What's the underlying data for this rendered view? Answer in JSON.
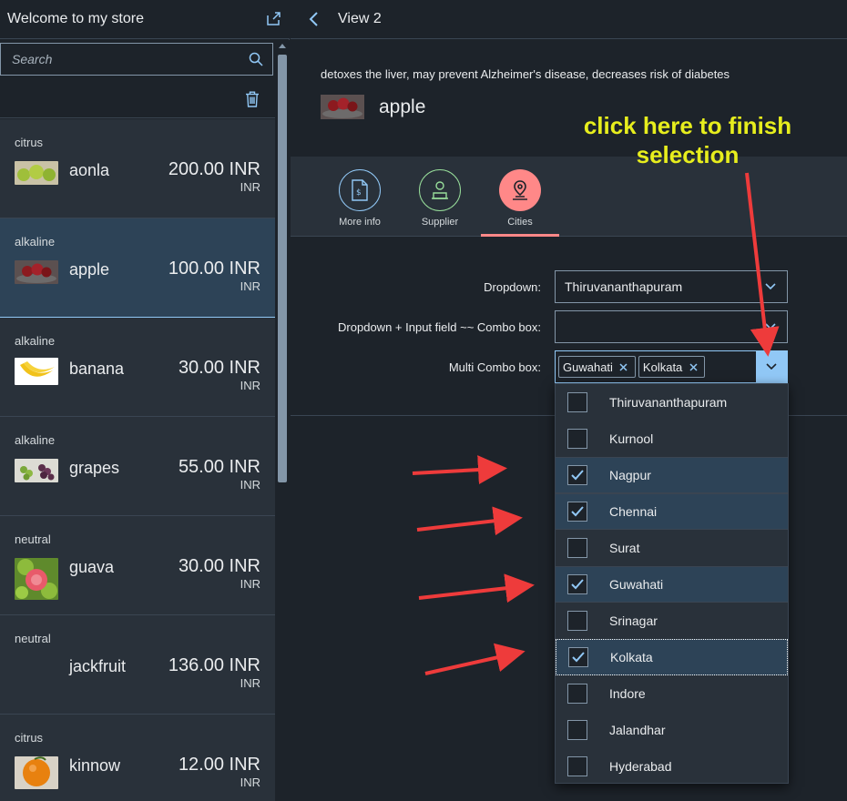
{
  "master": {
    "title": "Welcome to my store",
    "search_placeholder": "Search",
    "items": [
      {
        "category": "citrus",
        "name": "aonla",
        "price": "200.00 INR",
        "unit": "INR",
        "selected": false
      },
      {
        "category": "alkaline",
        "name": "apple",
        "price": "100.00 INR",
        "unit": "INR",
        "selected": true
      },
      {
        "category": "alkaline",
        "name": "banana",
        "price": "30.00 INR",
        "unit": "INR",
        "selected": false
      },
      {
        "category": "alkaline",
        "name": "grapes",
        "price": "55.00 INR",
        "unit": "INR",
        "selected": false
      },
      {
        "category": "neutral",
        "name": "guava",
        "price": "30.00 INR",
        "unit": "INR",
        "selected": false
      },
      {
        "category": "neutral",
        "name": "jackfruit",
        "price": "136.00 INR",
        "unit": "INR",
        "selected": false
      },
      {
        "category": "citrus",
        "name": "kinnow",
        "price": "12.00 INR",
        "unit": "INR",
        "selected": false
      }
    ]
  },
  "detail": {
    "title": "View 2",
    "description": "detoxes the liver, may prevent Alzheimer's disease, decreases risk of diabetes",
    "object_title": "apple",
    "tabs": [
      {
        "label": "More info",
        "icon": "document-money-icon",
        "color": "#91c8f6",
        "active": false
      },
      {
        "label": "Supplier",
        "icon": "supplier-icon",
        "color": "#97dd9a",
        "active": false
      },
      {
        "label": "Cities",
        "icon": "location-icon",
        "color": "#ff8888",
        "active": true
      }
    ]
  },
  "form": {
    "dropdown_label": "Dropdown:",
    "dropdown_value": "Thiruvananthapuram",
    "combo_label": "Dropdown + Input field ~~ Combo box:",
    "combo_value": "",
    "multi_label": "Multi Combo box:",
    "tokens": [
      "Guwahati",
      "Kolkata"
    ]
  },
  "cities": [
    {
      "name": "Thiruvananthapuram",
      "checked": false
    },
    {
      "name": "Kurnool",
      "checked": false
    },
    {
      "name": "Nagpur",
      "checked": true
    },
    {
      "name": "Chennai",
      "checked": true
    },
    {
      "name": "Surat",
      "checked": false
    },
    {
      "name": "Guwahati",
      "checked": true
    },
    {
      "name": "Srinagar",
      "checked": false
    },
    {
      "name": "Kolkata",
      "checked": true,
      "focused": true
    },
    {
      "name": "Indore",
      "checked": false
    },
    {
      "name": "Jalandhar",
      "checked": false
    },
    {
      "name": "Hyderabad",
      "checked": false
    }
  ],
  "annotation": {
    "line1": "click here to finish",
    "line2": "selection",
    "color": "#e7ee1d",
    "arrow_color": "#ee3b3b"
  }
}
